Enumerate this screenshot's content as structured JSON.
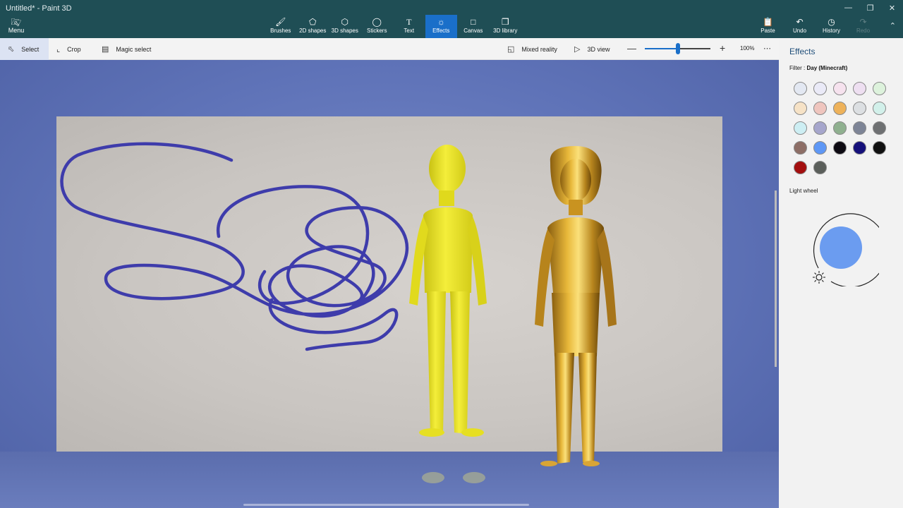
{
  "window": {
    "title": "Untitled* - Paint 3D",
    "controls": [
      "minimize",
      "restore",
      "close"
    ]
  },
  "menu": {
    "label": "Menu",
    "icon": "folder-icon"
  },
  "tool_tabs": [
    {
      "label": "Brushes",
      "icon": "brush-icon",
      "active": false
    },
    {
      "label": "2D shapes",
      "icon": "2d-shapes-icon",
      "active": false
    },
    {
      "label": "3D shapes",
      "icon": "3d-shapes-icon",
      "active": false
    },
    {
      "label": "Stickers",
      "icon": "stickers-icon",
      "active": false
    },
    {
      "label": "Text",
      "icon": "text-icon",
      "active": false
    },
    {
      "label": "Effects",
      "icon": "effects-icon",
      "active": true
    },
    {
      "label": "Canvas",
      "icon": "canvas-icon",
      "active": false
    },
    {
      "label": "3D library",
      "icon": "3d-library-icon",
      "active": false
    }
  ],
  "actions": [
    {
      "label": "Paste",
      "icon": "paste-icon",
      "enabled": true
    },
    {
      "label": "Undo",
      "icon": "undo-icon",
      "enabled": true
    },
    {
      "label": "History",
      "icon": "history-icon",
      "enabled": true
    },
    {
      "label": "Redo",
      "icon": "redo-icon",
      "enabled": false
    }
  ],
  "subtoolbar": {
    "select": "Select",
    "crop": "Crop",
    "magic_select": "Magic select",
    "mixed_reality": "Mixed reality",
    "view_3d": "3D view",
    "zoom_value": "100%",
    "zoom_fraction": 0.5
  },
  "panel": {
    "title": "Effects",
    "filter_label": "Filter :",
    "filter_value": "Day (Minecraft)",
    "light_wheel_label": "Light wheel",
    "light_color": "#6b9cf0",
    "swatches": [
      "#e3e8f2",
      "#eaeaf7",
      "#f6e2ee",
      "#eedff1",
      "#ddf2dc",
      "#f6e2c6",
      "#efc5be",
      "#eeb25a",
      "#dcdfe2",
      "#d2f0ea",
      "#cdeef3",
      "#a6a6cc",
      "#8fb08f",
      "#7d8496",
      "#6e7072",
      "#8d6e66",
      "#5e97f5",
      "#0d0a12",
      "#15107a",
      "#101010",
      "#a30f0f",
      "#5b5f5b"
    ]
  },
  "colors": {
    "title_bar": "#1f4e55",
    "accent": "#1a6fc9",
    "scribble": "#3e3cab",
    "figure_yellow": "#e6e01f",
    "figure_gold": "#c9941c"
  }
}
